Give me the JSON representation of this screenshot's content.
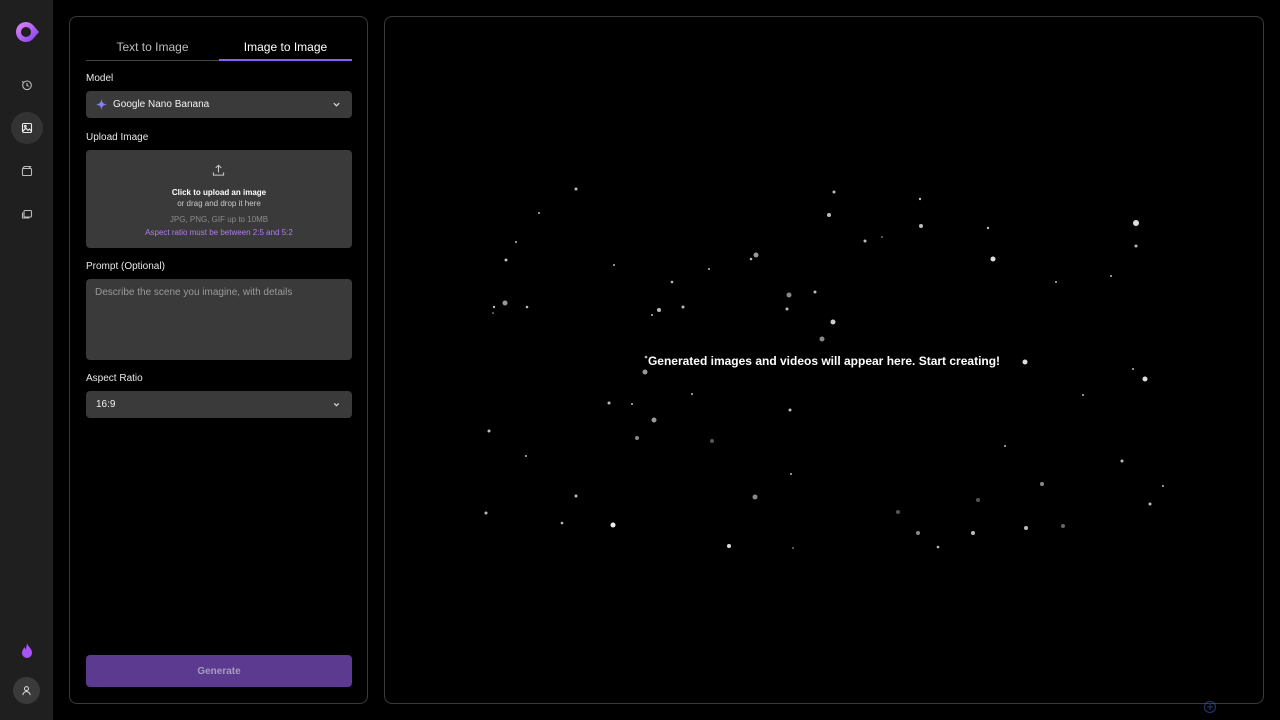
{
  "tabs": [
    {
      "label": "Text to Image",
      "active": false
    },
    {
      "label": "Image to Image",
      "active": true
    }
  ],
  "model": {
    "label": "Model",
    "selected": "Google Nano Banana",
    "icon": "sparkle-icon"
  },
  "upload": {
    "label": "Upload Image",
    "primary": "Click to upload an image",
    "secondary": "or drag and drop it here",
    "formats": "JPG, PNG, GIF up to 10MB",
    "ratio_note": "Aspect ratio must be between 2:5 and 5:2"
  },
  "prompt": {
    "label": "Prompt (Optional)",
    "placeholder": "Describe the scene you imagine, with details",
    "value": ""
  },
  "aspect_ratio": {
    "label": "Aspect Ratio",
    "selected": "16:9"
  },
  "generate_label": "Generate",
  "output": {
    "empty_message": "Generated images and videos will appear here. Start creating!"
  },
  "sidebar": {
    "items": [
      {
        "name": "history-icon"
      },
      {
        "name": "image-icon",
        "active": true
      },
      {
        "name": "video-icon"
      },
      {
        "name": "gallery-icon"
      }
    ]
  },
  "colors": {
    "accent": "#8b5cf6",
    "generate_bg": "#5b3a8f",
    "field_bg": "#3a3a3a",
    "rail_bg": "#1f1f1f"
  }
}
